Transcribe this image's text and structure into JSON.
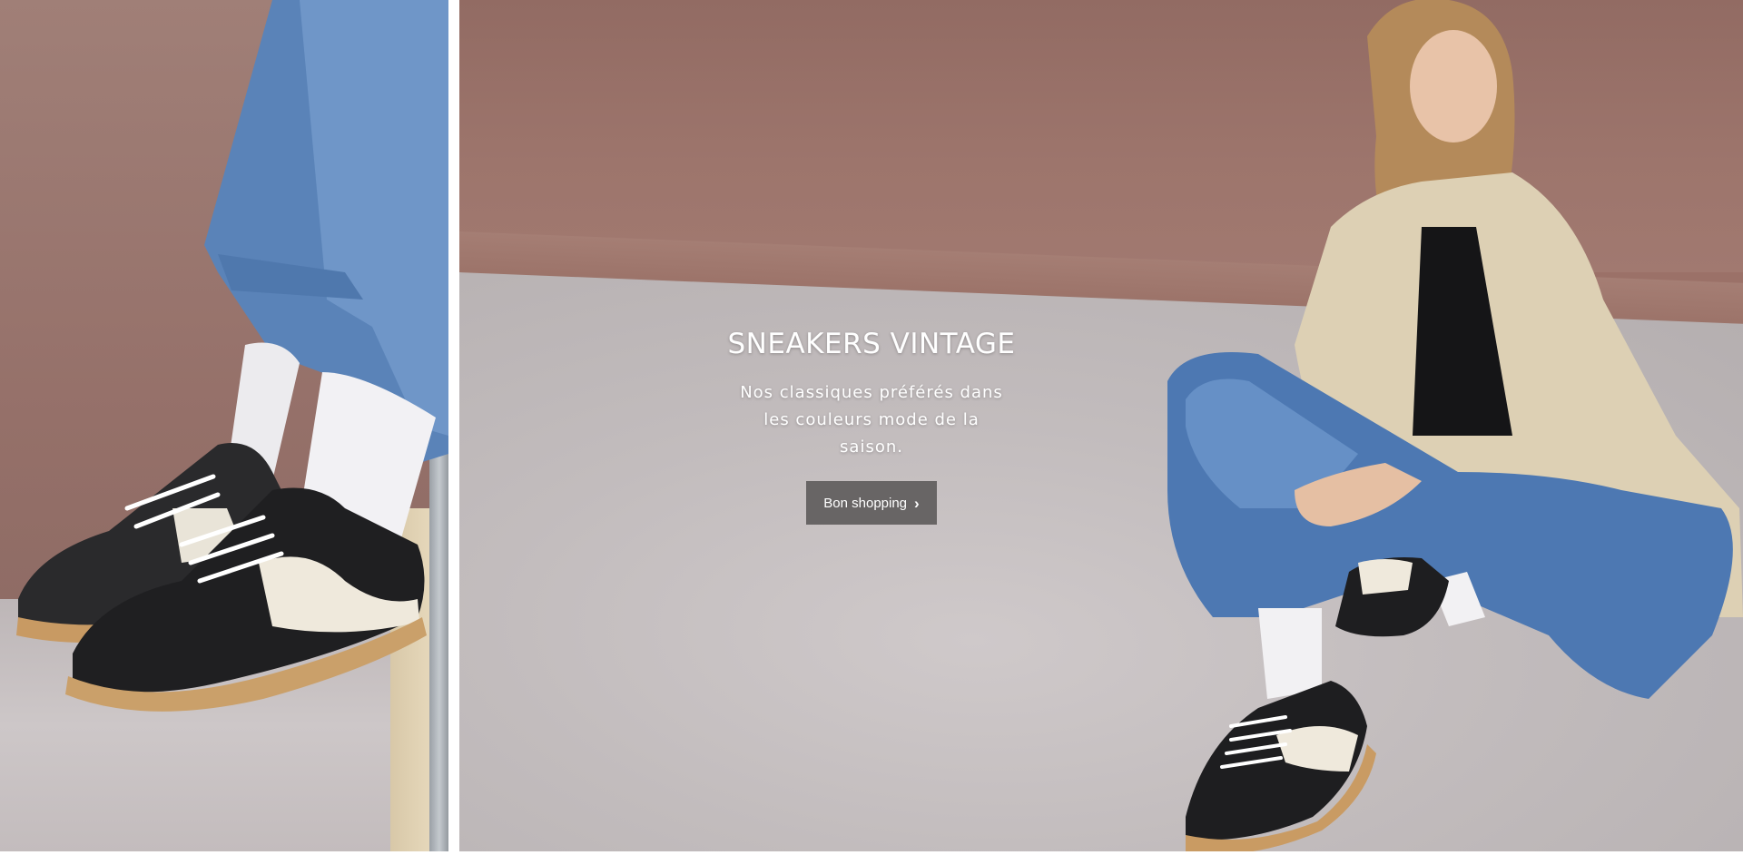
{
  "hero": {
    "title": "SNEAKERS VINTAGE",
    "subtitle": "Nos classiques préférés dans les couleurs mode de la saison.",
    "cta_label": "Bon shopping",
    "cta_icon": "chevron-right-icon"
  },
  "images": {
    "left": "model legs wearing blue jeans, white socks and black-and-white vintage sneakers",
    "right": "model in beige trench coat and blue jeans sitting on floor wearing black-and-white vintage sneakers"
  },
  "colors": {
    "wall": "#9b7168",
    "floor": "#c2bcbd",
    "cta_background": "#686565",
    "text": "#ffffff"
  }
}
